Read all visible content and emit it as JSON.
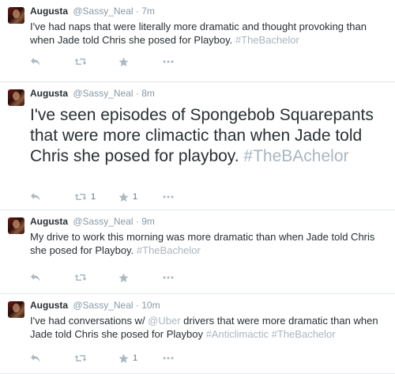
{
  "tweets": [
    {
      "name": "Augusta",
      "handle": "@Sassy_Neal",
      "time": "7m",
      "text_parts": [
        "I've had naps that were literally more dramatic and thought provoking than when Jade told Chris she posed for Playboy. ",
        "#TheBachelor"
      ],
      "retweets": "",
      "favorites": ""
    },
    {
      "name": "Augusta",
      "handle": "@Sassy_Neal",
      "time": "8m",
      "text_parts": [
        "I've seen episodes of Spongebob Squarepants that were more climactic than when Jade told Chris she posed for playboy. ",
        "#TheBAchelor"
      ],
      "retweets": "1",
      "favorites": "1"
    },
    {
      "name": "Augusta",
      "handle": "@Sassy_Neal",
      "time": "9m",
      "text_parts": [
        "My drive to work this morning was more dramatic than when Jade told Chris she posed for Playboy. ",
        "#TheBachelor"
      ],
      "retweets": "",
      "favorites": ""
    },
    {
      "name": "Augusta",
      "handle": "@Sassy_Neal",
      "time": "10m",
      "text_parts": [
        "I've had conversations w/ ",
        "@Uber",
        " drivers that were more dramatic than when Jade told Chris she posed for Playboy ",
        "#Anticlimactic",
        " ",
        "#TheBachelor"
      ],
      "retweets": "",
      "favorites": "1"
    }
  ],
  "separator": "·",
  "icons": [
    "reply-icon",
    "retweet-icon",
    "favorite-icon",
    "more-icon"
  ],
  "colors": {
    "text": "#292f33",
    "meta": "#8899a6",
    "link": "#a9b6c1",
    "divider": "#e1e8ed"
  }
}
